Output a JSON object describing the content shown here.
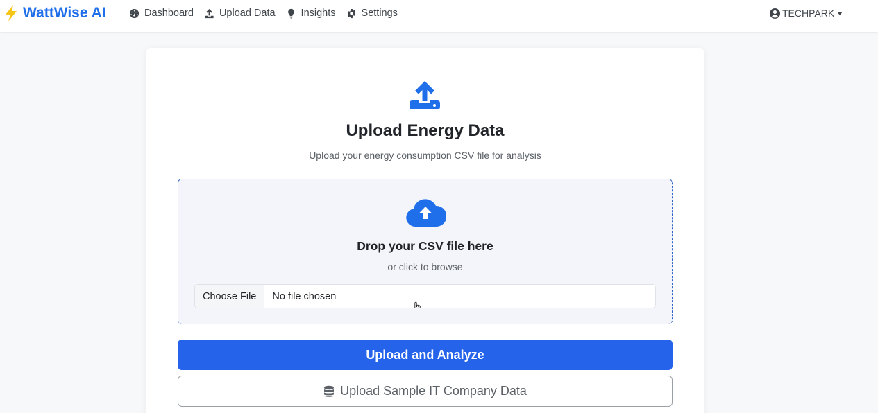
{
  "brand": {
    "name": "WattWise AI",
    "icon": "bolt-icon",
    "color": "#1f6feb",
    "bolt_color": "#f5c518"
  },
  "nav": {
    "items": [
      {
        "label": "Dashboard",
        "icon": "gauge-icon"
      },
      {
        "label": "Upload Data",
        "icon": "upload-icon"
      },
      {
        "label": "Insights",
        "icon": "lightbulb-icon"
      },
      {
        "label": "Settings",
        "icon": "gear-icon"
      }
    ],
    "user": {
      "label": "TECHPARK",
      "icon": "user-circle-icon"
    }
  },
  "main": {
    "title": "Upload Energy Data",
    "subtitle": "Upload your energy consumption CSV file for analysis",
    "header_icon": "upload-icon",
    "dropzone": {
      "icon": "cloud-upload-icon",
      "title": "Drop your CSV file here",
      "subtitle": "or click to browse",
      "file_button_label": "Choose File",
      "file_status": "No file chosen"
    },
    "primary_button": "Upload and Analyze",
    "sample_button": {
      "label": "Upload Sample IT Company Data",
      "icon": "database-icon"
    }
  },
  "colors": {
    "accent": "#2563eb",
    "dropzone_border": "#2c64c7",
    "dropzone_bg": "#f3f5fb"
  }
}
